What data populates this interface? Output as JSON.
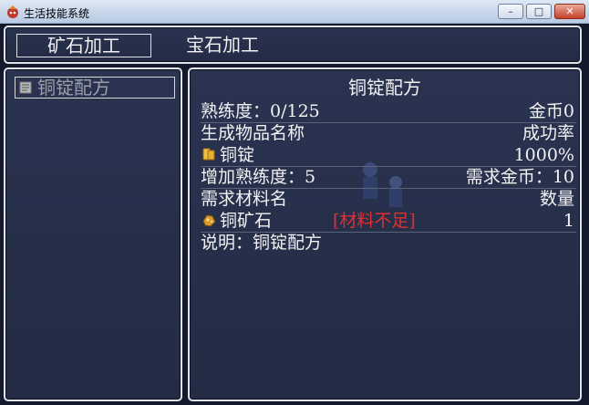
{
  "window": {
    "title": "生活技能系统",
    "buttons": {
      "minimize": "–",
      "maximize": "□",
      "close": "✕"
    }
  },
  "tabs": [
    {
      "label": "矿石加工",
      "selected": true
    },
    {
      "label": "宝石加工",
      "selected": false
    }
  ],
  "recipe_list": [
    {
      "label": "铜锭配方",
      "icon": "scroll-icon"
    }
  ],
  "detail": {
    "title": "铜锭配方",
    "proficiency_label": "熟练度：0/125",
    "gold_label": "金币0",
    "product_header": "生成物品名称",
    "success_header": "成功率",
    "product_name": "铜锭",
    "success_rate": "1000%",
    "gain_label": "增加熟练度：5",
    "cost_label": "需求金币：10",
    "material_header": "需求材料名",
    "quantity_header": "数量",
    "material_name": "铜矿石",
    "material_status": "[材料不足]",
    "material_quantity": "1",
    "description": "说明：铜锭配方"
  },
  "colors": {
    "panel_bg": "#252d48",
    "border": "#dfe3ea",
    "text": "#f2f2f2",
    "warning": "#e03030"
  }
}
